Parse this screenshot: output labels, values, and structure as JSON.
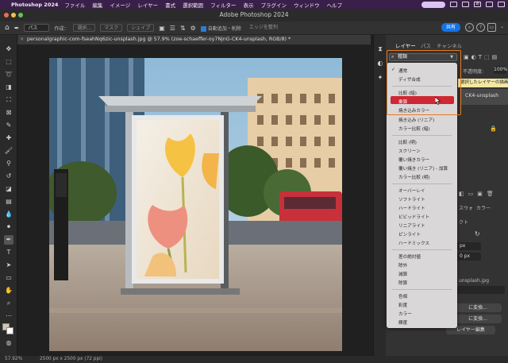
{
  "menubar": {
    "app_name": "Photoshop 2024",
    "items": [
      "ファイル",
      "編集",
      "イメージ",
      "レイヤー",
      "書式",
      "選択範囲",
      "フィルター",
      "表示",
      "プラグイン",
      "ウィンドウ",
      "ヘルプ"
    ],
    "status_pill": "あ"
  },
  "window": {
    "title": "Adobe Photoshop 2024"
  },
  "options_bar": {
    "path_mode": "パス",
    "create_label": "作成：",
    "select_btn": "選択...",
    "mask_btn": "マスク",
    "shape_btn": "シェイプ",
    "auto_add_delete": "自動追加・削除",
    "align_edges": "エッジを整列",
    "share_label": "共有"
  },
  "document": {
    "tab_label": "personalgraphic-com-fseahNq6zic-unsplash.jpg @ 57.9% (zoe-schaeffer-oy7NjnG-CK4-unsplash, RGB/8) *",
    "zoom": "57.92%",
    "size_info": "2500 px x 2500 px (72 ppi)"
  },
  "layers_panel": {
    "tabs": [
      "レイヤー",
      "パス",
      "チャンネル"
    ],
    "kind_filter": "種類",
    "opacity_label": "不透明度:",
    "opacity_value": "100%",
    "tooltip": "選択したレイヤーの描画モ",
    "layer_name": "CK4-unsplash"
  },
  "blend_menu": {
    "selected": "通常",
    "groups": [
      [
        "通常",
        "ディザ合成"
      ],
      [
        "比較 (暗)",
        "乗算",
        "焼き込みカラー",
        "焼き込み (リニア)",
        "カラー比較 (暗)"
      ],
      [
        "比較 (明)",
        "スクリーン",
        "覆い焼きカラー",
        "覆い焼き (リニア) - 加算",
        "カラー比較 (明)"
      ],
      [
        "オーバーレイ",
        "ソフトライト",
        "ハードライト",
        "ビビッドライト",
        "リニアライト",
        "ピンライト",
        "ハードミックス"
      ],
      [
        "差の絶対値",
        "除外",
        "減算",
        "除算"
      ],
      [
        "色相",
        "彩度",
        "カラー",
        "輝度"
      ]
    ],
    "highlighted": "乗算"
  },
  "properties_panel": {
    "tab_fragment_1": "スウォ",
    "tab_fragment_2": "カラー",
    "fragment_label": "クト",
    "px_value_1": "px",
    "px_value_2": "0 px",
    "file_fragment": "unsplash.jpg",
    "btn_1": "に変換...",
    "btn_2": "に変換...",
    "btn_3": "レイヤー編集"
  },
  "colors": {
    "accent": "#1473e6",
    "highlight": "#cf2733",
    "annotation": "#e8781f",
    "menubar": "#3a1f4a"
  }
}
